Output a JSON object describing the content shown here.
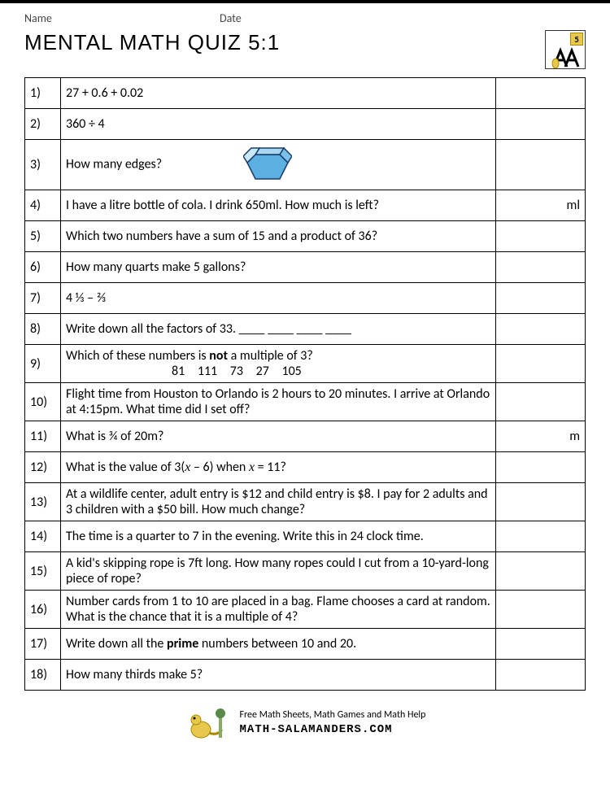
{
  "header": {
    "name_label": "Name",
    "date_label": "Date",
    "title": "MENTAL MATH QUIZ 5:1",
    "badge": "5"
  },
  "questions": [
    {
      "n": "1)",
      "text": "27 + 0.6 + 0.02",
      "unit": "",
      "h": "reg"
    },
    {
      "n": "2)",
      "text": "360 ÷ 4",
      "unit": "",
      "h": "reg"
    },
    {
      "n": "3)",
      "text": "How many edges?",
      "unit": "",
      "h": "tall",
      "hex": true
    },
    {
      "n": "4)",
      "text": "I have a litre bottle of cola. I drink 650ml. How much is left?",
      "unit": "ml",
      "h": "reg"
    },
    {
      "n": "5)",
      "text": "Which two numbers have a sum of 15 and a product of 36?",
      "unit": "",
      "h": "reg"
    },
    {
      "n": "6)",
      "text": "How many quarts make 5 gallons?",
      "unit": "",
      "h": "reg"
    },
    {
      "n": "7)",
      "text": "4 ⅓ – ⅔",
      "unit": "",
      "h": "reg"
    },
    {
      "n": "8)",
      "text": "Write down all the factors of 33.   ____    ____    ____    ____",
      "unit": "",
      "h": "reg"
    },
    {
      "n": "9)",
      "line1a": "Which of these numbers is ",
      "line1b": "not",
      "line1c": " a multiple of 3?",
      "line2": "81   111   73   27   105",
      "unit": "",
      "h": "two",
      "special": "q9"
    },
    {
      "n": "10)",
      "text": "Flight time from Houston to Orlando is 2 hours to 20 minutes. I arrive at Orlando at 4:15pm. What time did I set off?",
      "unit": "",
      "h": "two"
    },
    {
      "n": "11)",
      "text": "What is ¾ of 20m?",
      "unit": "m",
      "h": "reg"
    },
    {
      "n": "12)",
      "pre": "What is the value of 3(",
      "var1": "x",
      "mid": " – 6) when ",
      "var2": "x",
      "post": " = 11?",
      "unit": "",
      "h": "reg",
      "special": "q12"
    },
    {
      "n": "13)",
      "text": "At a wildlife center, adult entry is $12 and child entry is $8. I pay for 2 adults and 3 children with a $50 bill. How much change?",
      "unit": "",
      "h": "two"
    },
    {
      "n": "14)",
      "text": "The time is a quarter to 7 in the evening. Write this in 24 clock time.",
      "unit": "",
      "h": "reg"
    },
    {
      "n": "15)",
      "text": "A kid's skipping rope is 7ft long. How many ropes could I cut from a 10-yard-long piece of rope?",
      "unit": "",
      "h": "two"
    },
    {
      "n": "16)",
      "text": "Number cards from 1 to 10 are placed in a bag. Flame chooses a card at random. What is the chance that it is a multiple of 4?",
      "unit": "",
      "h": "two"
    },
    {
      "n": "17)",
      "pre": "Write down all the ",
      "bold": "prime",
      "post": " numbers between 10 and 20.",
      "unit": "",
      "h": "reg",
      "special": "q17"
    },
    {
      "n": "18)",
      "text": "How many thirds make 5?",
      "unit": "",
      "h": "reg"
    }
  ],
  "footer": {
    "line1": "Free Math Sheets, Math Games and Math Help",
    "site": "MATH-SALAMANDERS.COM"
  }
}
